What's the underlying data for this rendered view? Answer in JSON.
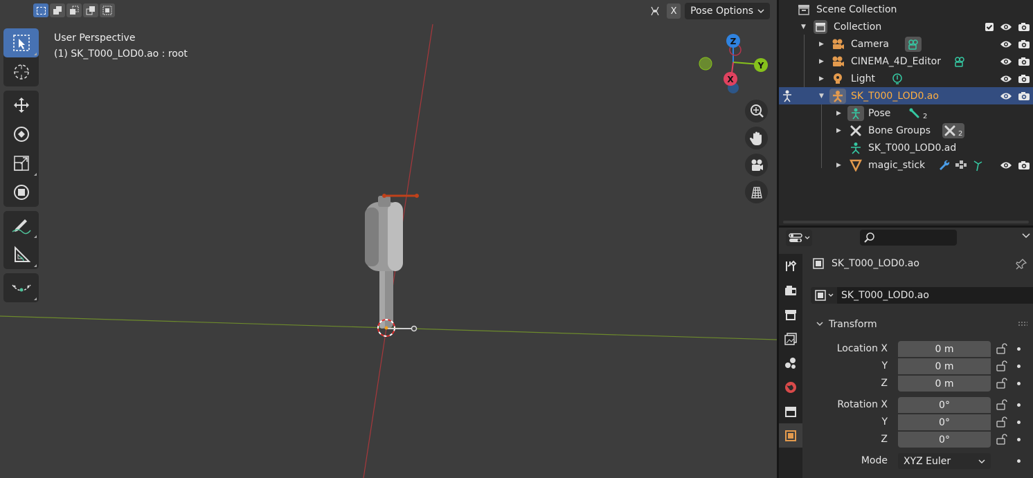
{
  "viewport": {
    "perspective_label": "User Perspective",
    "context_label": "(1) SK_T000_LOD0.ao : root",
    "select_modes": [
      "select-new-icon",
      "select-extend-icon",
      "select-subtract-icon",
      "select-invert-icon",
      "select-intersect-icon"
    ],
    "close_label": "X",
    "pose_options_label": "Pose Options",
    "gizmo": {
      "z_label": "Z",
      "y_label": "Y",
      "x_label": "X"
    },
    "tools": [
      "select-box-icon",
      "cursor-icon",
      "move-icon",
      "rotate-icon",
      "scale-icon",
      "transform-icon",
      "annotate-icon",
      "measure-icon",
      "pose-relax-icon"
    ],
    "nav_buttons": [
      "zoom-icon",
      "pan-hand-icon",
      "camera-view-icon",
      "grid-projection-icon"
    ],
    "colors": {
      "x_axis": "#e0425f",
      "y_axis": "#86c11c",
      "z_axis": "#2f83e0",
      "active_tool": "#4772b3"
    }
  },
  "outliner": {
    "rows": [
      {
        "label": "Scene Collection",
        "icon": "scene-collection-icon"
      },
      {
        "label": "Collection",
        "icon": "collection-icon"
      },
      {
        "label": "Camera",
        "icon": "camera-object-icon"
      },
      {
        "label": "CINEMA_4D_Editor",
        "icon": "camera-object-icon"
      },
      {
        "label": "Light",
        "icon": "light-object-icon"
      },
      {
        "label": "SK_T000_LOD0.ao",
        "icon": "armature-object-icon"
      },
      {
        "label": "Pose",
        "icon": "pose-icon",
        "count": "2"
      },
      {
        "label": "Bone Groups",
        "icon": "bone-groups-icon",
        "count": "2"
      },
      {
        "label": "SK_T000_LOD0.ad",
        "icon": "armature-data-icon"
      },
      {
        "label": "magic_stick",
        "icon": "mesh-object-icon"
      }
    ]
  },
  "properties": {
    "object_name": "SK_T000_LOD0.ao",
    "datablock_name": "SK_T000_LOD0.ao",
    "panel_title": "Transform",
    "tabs": [
      "tool-tab-icon",
      "render-tab-icon",
      "output-tab-icon",
      "view-layer-tab-icon",
      "scene-tab-icon",
      "world-tab-icon",
      "collection-tab-icon",
      "object-tab-icon"
    ],
    "rows": [
      {
        "label": "Location X",
        "value": "0 m"
      },
      {
        "label": "Y",
        "value": "0 m"
      },
      {
        "label": "Z",
        "value": "0 m"
      },
      {
        "label": "Rotation X",
        "value": "0°"
      },
      {
        "label": "Y",
        "value": "0°"
      },
      {
        "label": "Z",
        "value": "0°"
      },
      {
        "label": "Mode",
        "value": "XYZ Euler"
      }
    ]
  }
}
